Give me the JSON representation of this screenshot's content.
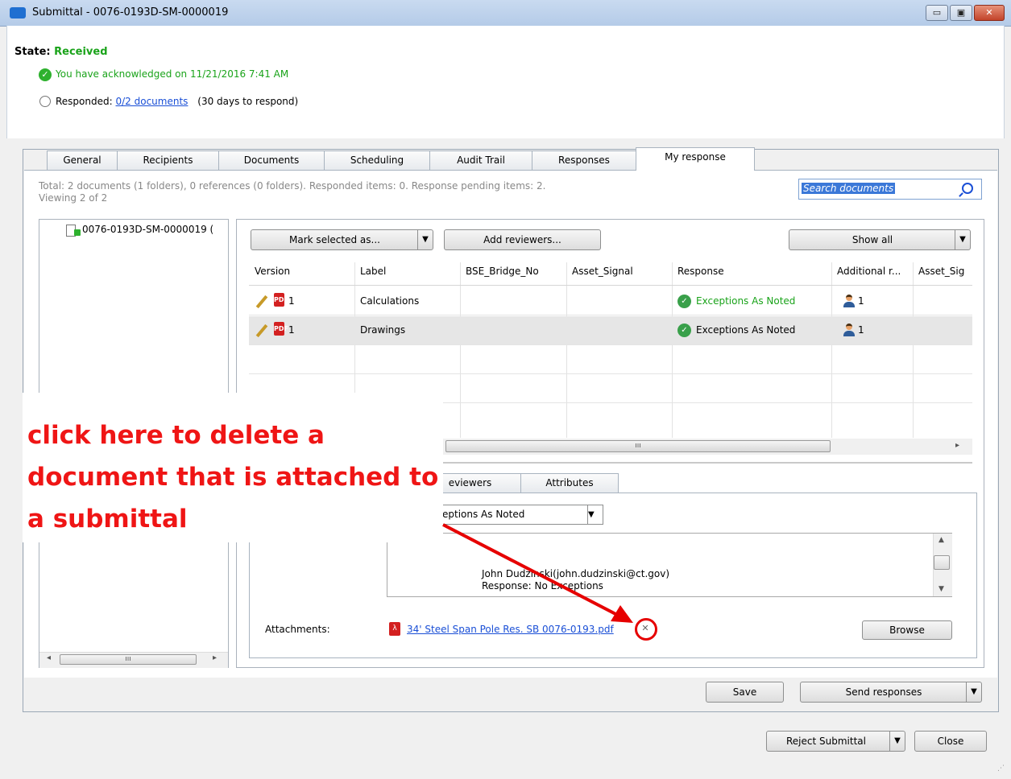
{
  "window": {
    "title": "Submittal - 0076-0193D-SM-0000019",
    "controls": {
      "minimize": "▭",
      "maximize": "▣",
      "close": "✕"
    }
  },
  "header": {
    "state_label": "State:",
    "state_value": "Received",
    "acknowledged": "You have acknowledged on 11/21/2016 7:41 AM",
    "responded_label": "Responded:",
    "responded_link": "0/2 documents",
    "responded_note": "(30 days to respond)"
  },
  "tabs": [
    "General",
    "Recipients",
    "Documents",
    "Scheduling",
    "Audit Trail",
    "Responses",
    "My response"
  ],
  "summary": {
    "line1": "Total: 2 documents (1 folders), 0 references (0 folders). Responded items: 0. Response pending items: 2.",
    "line2": "Viewing 2 of 2"
  },
  "search": {
    "placeholder": "Search documents"
  },
  "tree": {
    "item": "0076-0193D-SM-0000019 ("
  },
  "toolbar": {
    "mark_selected": "Mark selected as...",
    "add_reviewers": "Add reviewers...",
    "show_all": "Show all"
  },
  "grid": {
    "columns": [
      "Version",
      "Label",
      "BSE_Bridge_No",
      "Asset_Signal",
      "Response",
      "Additional r...",
      "Asset_Sig"
    ],
    "rows": [
      {
        "version": "1",
        "label": "Calculations",
        "response": "Exceptions As Noted",
        "reviewers": "1"
      },
      {
        "version": "1",
        "label": "Drawings",
        "response": "Exceptions As Noted",
        "reviewers": "1"
      }
    ]
  },
  "inner_tabs": [
    "eviewers",
    "Attributes"
  ],
  "response_select": "eptions As Noted",
  "comment": {
    "line1": "John Dudzinski(john.dudzinski@ct.gov)",
    "line2": "Response: No Exceptions"
  },
  "attachments": {
    "label": "Attachments:",
    "file": "34' Steel Span Pole Res.  SB    0076-0193.pdf",
    "browse": "Browse"
  },
  "actions": {
    "save": "Save",
    "send_responses": "Send responses",
    "reject": "Reject Submittal",
    "close": "Close"
  },
  "annotation": {
    "text": "click here to delete a document that is attached to a submittal",
    "color": "#ef1515"
  },
  "colors": {
    "accent": "#1a4fd6",
    "success": "#1aa31a",
    "annotation": "#e60000"
  }
}
